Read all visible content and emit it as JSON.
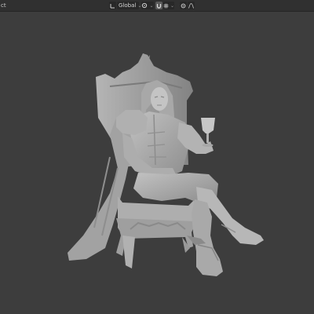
{
  "header": {
    "mode_stub": "ct",
    "transform_orientation": "Global",
    "pivot_icon": "pivot-point-icon",
    "snap_icon": "snap-magnet-icon",
    "proportional_icon": "proportional-edit-icon",
    "falloff_icon": "falloff-curve-icon"
  },
  "viewport": {
    "background_color": "#3d3d3d",
    "model_color": "#a9a9a9",
    "model": "3d-sculpt-seated-figure-on-throne-holding-goblet"
  }
}
